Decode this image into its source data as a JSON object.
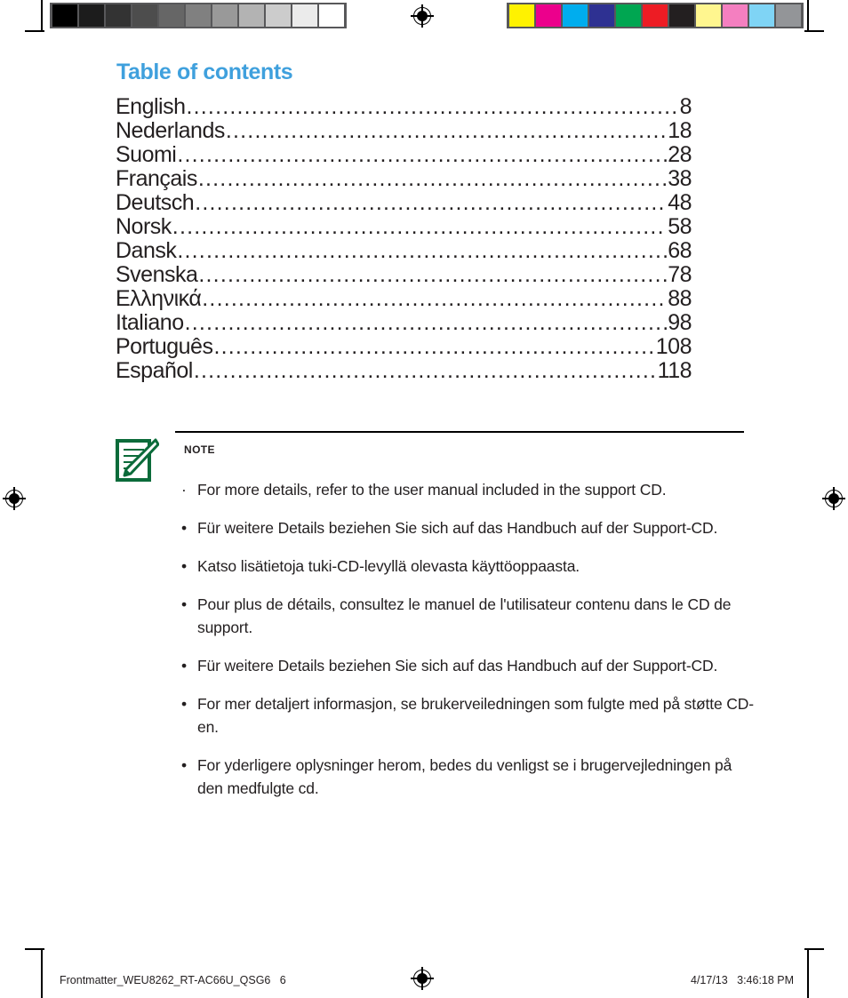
{
  "document": {
    "title": "Table of contents"
  },
  "toc": {
    "entries": [
      {
        "language": "English",
        "page": "8"
      },
      {
        "language": "Nederlands",
        "page": "18"
      },
      {
        "language": "Suomi",
        "page": "28"
      },
      {
        "language": "Français",
        "page": "38"
      },
      {
        "language": "Deutsch",
        "page": "48"
      },
      {
        "language": "Norsk",
        "page": "58"
      },
      {
        "language": "Dansk",
        "page": "68"
      },
      {
        "language": "Svenska",
        "page": "78"
      },
      {
        "language": "Ελληνικά",
        "page": "88"
      },
      {
        "language": "Italiano",
        "page": "98"
      },
      {
        "language": "Português",
        "page": "108"
      },
      {
        "language": "Español",
        "page": "118"
      }
    ],
    "leader_char": "."
  },
  "note": {
    "label": "NOTE",
    "icon": "note-pencil-icon",
    "icon_color": "#0b6b3a",
    "items": [
      {
        "bullet": "·",
        "text": "For more details, refer to the user manual included in the support CD."
      },
      {
        "bullet": "•",
        "text": "Für weitere Details beziehen Sie sich auf das Handbuch auf der Support-CD."
      },
      {
        "bullet": "•",
        "text": "Katso lisätietoja tuki-CD-levyllä olevasta käyttöoppaasta."
      },
      {
        "bullet": "•",
        "text": "Pour plus de détails, consultez le manuel de l'utilisateur contenu dans le CD de support."
      },
      {
        "bullet": "•",
        "text": "Für weitere Details beziehen Sie sich auf das Handbuch auf der Support-CD."
      },
      {
        "bullet": "•",
        "text": "For mer detaljert informasjon, se brukerveiledningen som fulgte med på støtte CD-en."
      },
      {
        "bullet": "•",
        "text": "For yderligere oplysninger herom, bedes du venligst se i brugervejledningen på den medfulgte cd."
      }
    ]
  },
  "footer": {
    "left": "Frontmatter_WEU8262_RT-AC66U_QSG6   6",
    "date": "4/17/13",
    "time": "3:46:18 PM"
  },
  "print_marks": {
    "grayscale_wedge": [
      "#000000",
      "#1c1c1c",
      "#333333",
      "#4d4d4d",
      "#666666",
      "#808080",
      "#999999",
      "#b3b3b3",
      "#cccccc",
      "#ebebeb",
      "#ffffff"
    ],
    "color_wedge": [
      "#fff200",
      "#ec008c",
      "#00adee",
      "#2e3192",
      "#00a651",
      "#ed1c24",
      "#231f20",
      "#fff68f",
      "#f47fc0",
      "#7fd4f5",
      "#939598"
    ],
    "registration_icon": "registration-target-icon"
  },
  "theme": {
    "accent": "#3fa0dd",
    "text": "#231f20",
    "note_green": "#0b6b3a"
  }
}
